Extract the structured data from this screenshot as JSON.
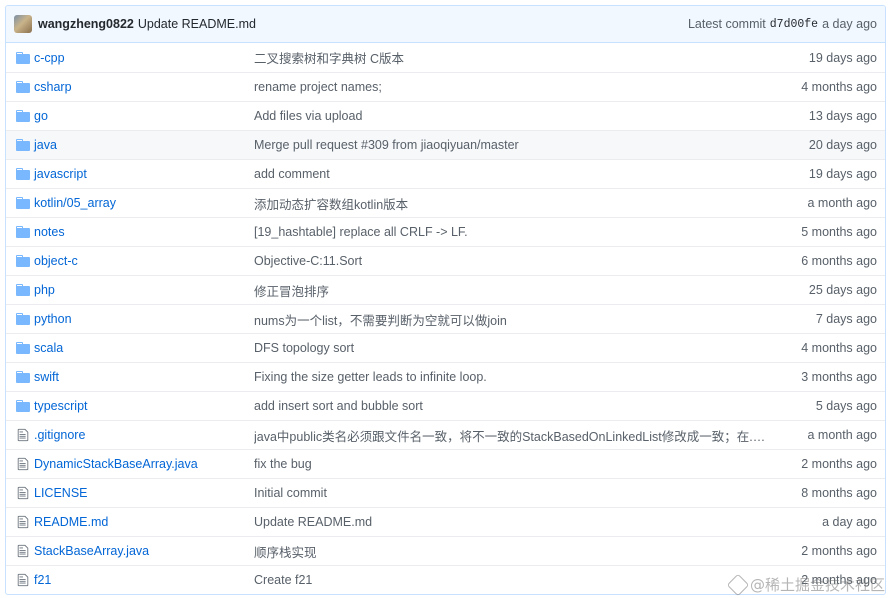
{
  "commit": {
    "author": "wangzheng0822",
    "message": "Update README.md",
    "latest_label": "Latest commit",
    "sha": "d7d00fe",
    "age": "a day ago"
  },
  "files": [
    {
      "type": "dir",
      "name": "c-cpp",
      "message": "二叉搜索树和字典树 C版本",
      "age": "19 days ago"
    },
    {
      "type": "dir",
      "name": "csharp",
      "message": "rename project names;",
      "age": "4 months ago"
    },
    {
      "type": "dir",
      "name": "go",
      "message": "Add files via upload",
      "age": "13 days ago"
    },
    {
      "type": "dir",
      "name": "java",
      "message": "Merge pull request #309 from jiaoqiyuan/master",
      "age": "20 days ago",
      "highlight": true
    },
    {
      "type": "dir",
      "name": "javascript",
      "message": "add comment",
      "age": "19 days ago"
    },
    {
      "type": "dir",
      "name": "kotlin/05_array",
      "message": "添加动态扩容数组kotlin版本",
      "age": "a month ago"
    },
    {
      "type": "dir",
      "name": "notes",
      "message": "[19_hashtable] replace all CRLF -> LF.",
      "age": "5 months ago"
    },
    {
      "type": "dir",
      "name": "object-c",
      "message": "Objective-C:11.Sort",
      "age": "6 months ago"
    },
    {
      "type": "dir",
      "name": "php",
      "message": "修正冒泡排序",
      "age": "25 days ago"
    },
    {
      "type": "dir",
      "name": "python",
      "message": "nums为一个list，不需要判断为空就可以做join",
      "age": "7 days ago"
    },
    {
      "type": "dir",
      "name": "scala",
      "message": "DFS topology sort",
      "age": "4 months ago"
    },
    {
      "type": "dir",
      "name": "swift",
      "message": "Fixing the size getter leads to infinite loop.",
      "age": "3 months ago"
    },
    {
      "type": "dir",
      "name": "typescript",
      "message": "add insert sort and bubble sort",
      "age": "5 days ago"
    },
    {
      "type": "file",
      "name": ".gitignore",
      "message": "java中public类名必须跟文件名一致，将不一致的StackBasedOnLinkedList修改成一致；在.gi...",
      "age": "a month ago"
    },
    {
      "type": "file",
      "name": "DynamicStackBaseArray.java",
      "message": "fix the bug",
      "age": "2 months ago"
    },
    {
      "type": "file",
      "name": "LICENSE",
      "message": "Initial commit",
      "age": "8 months ago"
    },
    {
      "type": "file",
      "name": "README.md",
      "message": "Update README.md",
      "age": "a day ago"
    },
    {
      "type": "file",
      "name": "StackBaseArray.java",
      "message": "顺序栈实现",
      "age": "2 months ago"
    },
    {
      "type": "file",
      "name": "f21",
      "message": "Create f21",
      "age": "2 months ago"
    }
  ],
  "watermark": "@稀土掘金技术社区",
  "colors": {
    "folder": "#79b8ff",
    "link": "#0366d6",
    "file_icon": "#6a737d"
  }
}
